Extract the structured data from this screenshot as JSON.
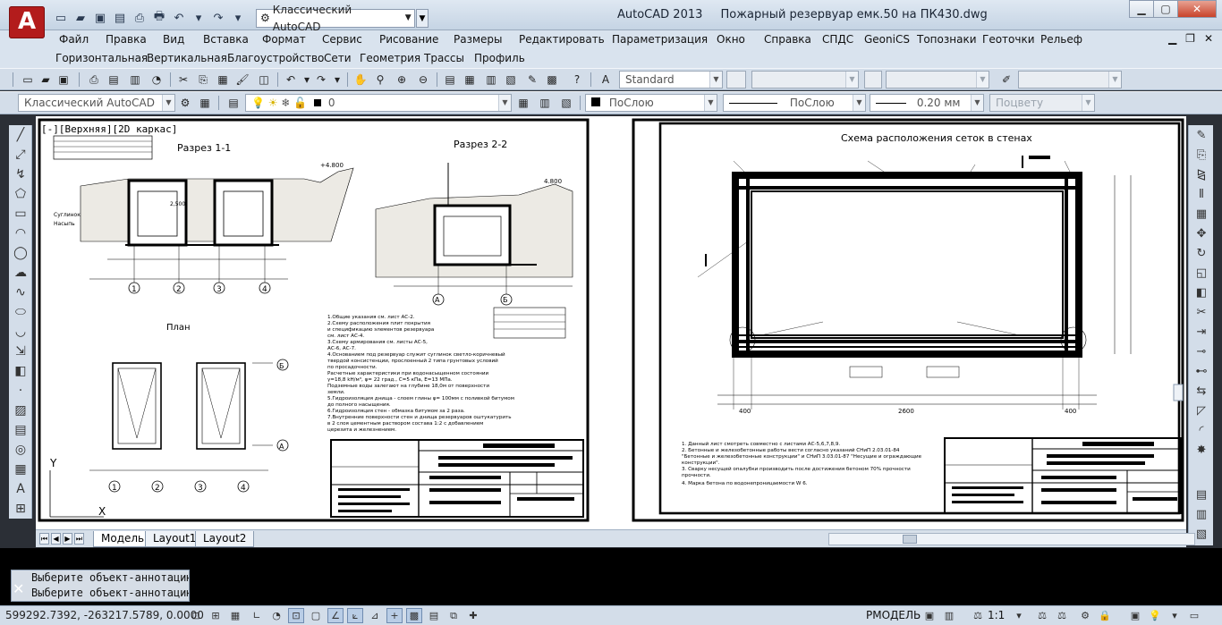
{
  "window": {
    "app_name": "AutoCAD 2013",
    "document": "Пожарный резервуар емк.50 на ПК430.dwg",
    "logo_letter": "A"
  },
  "quick_access": {
    "workspace": "Классический AutoCAD"
  },
  "menu_row1": [
    "Файл",
    "Правка",
    "Вид",
    "Вставка",
    "Формат",
    "Сервис",
    "Рисование",
    "Размеры",
    "Редактировать",
    "Параметризация",
    "Окно",
    "Справка",
    "СПДС",
    "GeoniCS",
    "Топознаки",
    "Геоточки",
    "Рельеф"
  ],
  "menu_row2": [
    "Горизонтальная",
    "Вертикальная",
    "Благоустройство",
    "Сети",
    "Геометрия",
    "Трассы",
    "Профиль"
  ],
  "toolbar1": {
    "text_style": "Standard"
  },
  "toolbar2": {
    "workspace": "Классический AutoCAD",
    "layer": "0",
    "color": "ПоСлою",
    "linetype": "ПоСлою",
    "lineweight": "0.20 мм",
    "plotstyle": "Поцвету"
  },
  "viewport": {
    "label": "[-][Верхняя][2D каркас]"
  },
  "drawing_left": {
    "section1_title": "Разрез 1-1",
    "section2_title": "Разрез 2-2",
    "plan_title": "План",
    "axis_marks": [
      "1",
      "2",
      "3",
      "4"
    ],
    "axis_marks_b": [
      "А",
      "Б"
    ],
    "notes": [
      "1.Общие указания см. лист АС-2.",
      "2.Схему расположения плит покрытия",
      "и спецификацию элементов резервуара",
      "см. лист АС-4.",
      "3.Схему армирования см. листы АС-5,",
      "АС-6, АС-7.",
      "4.Основанием под резервуар служит суглинок светло-коричневый",
      "твердой консистенции, прослоенный 2 типа грунтовых условий",
      "по просадочности.",
      "Расчетные характеристики при водонасыщенном состоянии",
      "γ=18,8 kH/м³, φ= 22 град., C=5 кПа, E=13 МПа.",
      "Подземные воды залегают на глубине 18,0м от поверхности",
      "земли.",
      "5.Гидроизоляция днища - слоем глины φ= 100мм с поливкой битумом",
      "до полного насыщения.",
      "6.Гидроизоляция стен - обмазка битумом за 2 раза.",
      "7.Внутренние поверхности стен и днища резервуаров оштукатурить",
      "в 2 слоя цементным раствором состава 1:2 с добавлением",
      "церезита и железнением."
    ]
  },
  "drawing_right": {
    "title": "Схема расположения сеток в стенах",
    "dims_bottom": [
      "400",
      "2600",
      "400"
    ],
    "notes": [
      "1. Данный лист смотреть совместно с листами АС-5,6,7,8,9.",
      "2. Бетонные и железобетонные работы вести согласно указаний СНиП 2.03.01-84",
      "\"Бетонные и железобетонные конструкции\" и СНиП 3.03.01-87 \"Несущие и ограждающие",
      "конструкции\".",
      "3. Сварку несущей опалубки производить после достижения бетоном 70% прочности",
      "прочности.",
      "4. Марка бетона по водонепроницаемости W 6."
    ]
  },
  "layout_tabs": [
    "Модель",
    "Layout1",
    "Layout2"
  ],
  "command": {
    "lines": [
      "Выберите объект-аннотацию",
      "Выберите объект-аннотацию"
    ]
  },
  "status": {
    "coords": "599292.7392, -263217.5789, 0.0000",
    "space": "РМОДЕЛЬ",
    "scale": "1:1"
  },
  "colors": {
    "title_bar": "#c5d4e4",
    "logo": "#b31c1c",
    "drawing_bg": "#ffffff",
    "command_bg": "#000000"
  }
}
